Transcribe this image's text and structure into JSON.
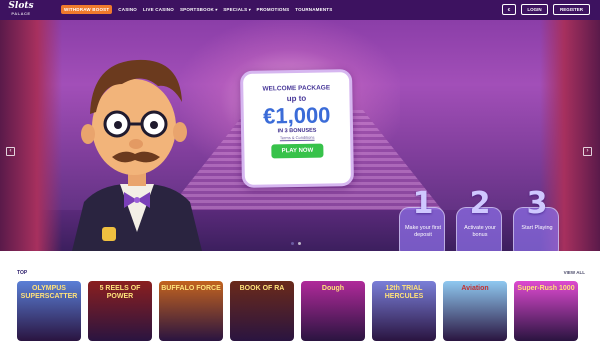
{
  "brand": {
    "logo_text": "Slots",
    "logo_sub": "PALACE"
  },
  "nav": {
    "items": [
      {
        "label": "WITHDRAW BOOST",
        "icon": ""
      },
      {
        "label": "CASINO",
        "icon": ""
      },
      {
        "label": "LIVE CASINO",
        "icon": ""
      },
      {
        "label": "SPORTSBOOK",
        "icon": "chevron-down-icon"
      },
      {
        "label": "SPECIALS",
        "icon": "chevron-down-icon"
      },
      {
        "label": "PROMOTIONS",
        "icon": ""
      },
      {
        "label": "TOURNAMENTS",
        "icon": ""
      }
    ],
    "currency_symbol": "€",
    "login_label": "LOGIN",
    "register_label": "REGISTER"
  },
  "hero": {
    "promo_line1": "WELCOME PACKAGE",
    "promo_line2": "up to",
    "promo_amount": "€1,000",
    "promo_line3": "IN 3 BONUSES",
    "promo_terms": "Terms & Conditions",
    "play_label": "PLAY NOW",
    "steps": [
      {
        "number": "1",
        "label": "Make your first deposit"
      },
      {
        "number": "2",
        "label": "Activate your bonus"
      },
      {
        "number": "3",
        "label": "Start Playing"
      }
    ],
    "slide_count": 2,
    "active_slide": 1
  },
  "games": {
    "section_title": "TOP",
    "view_all_label": "VIEW ALL",
    "tiles": [
      {
        "title": "OLYMPUS SUPERSCATTER",
        "bg": "#5a7fd6"
      },
      {
        "title": "5 REELS OF POWER",
        "bg": "#8a1f1f"
      },
      {
        "title": "BUFFALO FORCE",
        "bg": "#c2631f"
      },
      {
        "title": "BOOK OF RA",
        "bg": "#6a2a1a"
      },
      {
        "title": "Dough",
        "bg": "#b02a9a"
      },
      {
        "title": "12th TRIAL HERCULES",
        "bg": "#7a7fd8"
      },
      {
        "title": "Aviation",
        "bg": "#8fc8f0"
      },
      {
        "title": "Super-Rush 1000",
        "bg": "#dd4ad0"
      }
    ]
  },
  "colors": {
    "nav_bg": "#3d1260",
    "accent_orange": "#f07a2c",
    "play_green": "#37c24a",
    "title_navy": "#2a1b6a"
  }
}
